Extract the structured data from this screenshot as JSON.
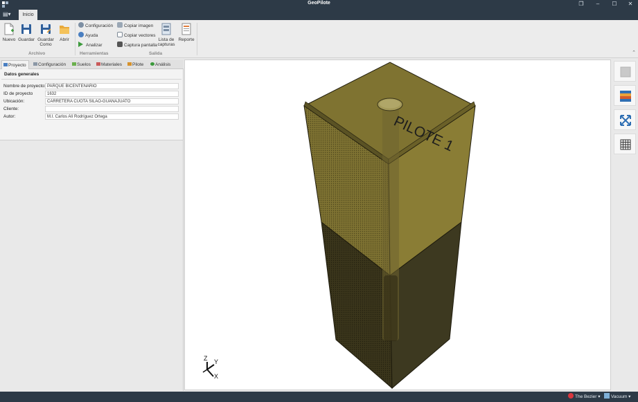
{
  "window": {
    "title": "GeoPilote",
    "controls": [
      "restore-down-icon",
      "minimize-icon",
      "maximize-icon",
      "close-icon"
    ]
  },
  "ribbon": {
    "tab_active": "Inicio",
    "groups": {
      "archivo": {
        "label": "Archivo",
        "nuevo": "Nuevo",
        "guardar": "Guardar",
        "guardar_como_1": "Guardar",
        "guardar_como_2": "Como",
        "abrir": "Abrir"
      },
      "herramientas": {
        "label": "Herramientas",
        "configuracion": "Configuración",
        "ayuda": "Ayuda",
        "analizar": "Analizar"
      },
      "salida": {
        "label": "Salida",
        "copiar_imagen": "Copiar imagen",
        "copiar_vectores": "Copiar vectores",
        "captura_pantalla": "Captura pantalla",
        "lista_capturas_1": "Lista de",
        "lista_capturas_2": "capturas",
        "reporte": "Reporte"
      }
    }
  },
  "panel_tabs": {
    "proyecto": "Proyecto",
    "configuracion": "Configuración",
    "suelos": "Suelos",
    "materiales": "Materiales",
    "pilote": "Pilote",
    "analisis": "Análisis"
  },
  "general": {
    "section_title": "Datos generales",
    "fields": [
      {
        "label": "Nombre de proyecto:",
        "value": "PARQUE BICENTENARIO"
      },
      {
        "label": "ID de proyecto",
        "value": "1632"
      },
      {
        "label": "Ubicación:",
        "value": "CARRETERA CUOTA SILAO-GUANAJUATO"
      },
      {
        "label": "Cliente:",
        "value": ""
      },
      {
        "label": "Autor:",
        "value": "M.I. Carlos Alí Rodríguez Ortega"
      }
    ]
  },
  "viewport": {
    "model_label": "PILOTE 1",
    "axis_z": "Z",
    "axis_y": "Y",
    "axis_x": "X"
  },
  "right_tools": [
    "cube-view-icon",
    "soil-layers-icon",
    "fit-extents-icon",
    "grid-icon"
  ],
  "statusbar": {
    "theme": "The Bezier",
    "style": "Vacuum"
  },
  "colors": {
    "titlebar": "#2d3a47",
    "soil_upper": "#8a7d35",
    "soil_lower": "#3f3a1e",
    "accent_blue": "#2f6fb3"
  }
}
